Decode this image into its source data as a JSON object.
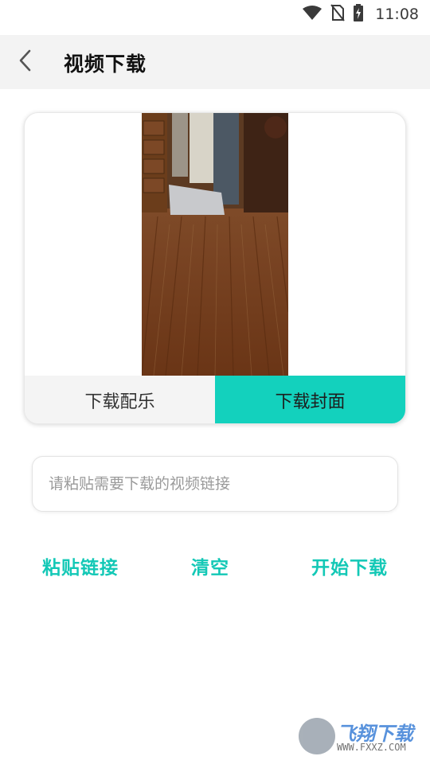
{
  "status_bar": {
    "time": "11:08",
    "icons": [
      "wifi-icon",
      "no-sim-icon",
      "battery-charging-icon"
    ]
  },
  "header": {
    "title": "视频下载",
    "back_icon": "chevron-left-icon"
  },
  "preview": {
    "music_button": "下载配乐",
    "cover_button": "下载封面"
  },
  "link_input": {
    "value": "",
    "placeholder": "请粘贴需要下载的视频链接"
  },
  "actions": {
    "paste": "粘贴链接",
    "clear": "清空",
    "start": "开始下载"
  },
  "watermark": {
    "title": "飞翔下载",
    "url": "WWW.FXXZ.COM"
  },
  "colors": {
    "accent": "#13d1bd",
    "accent_text": "#13c8b6",
    "header_bg": "#f3f3f3"
  }
}
